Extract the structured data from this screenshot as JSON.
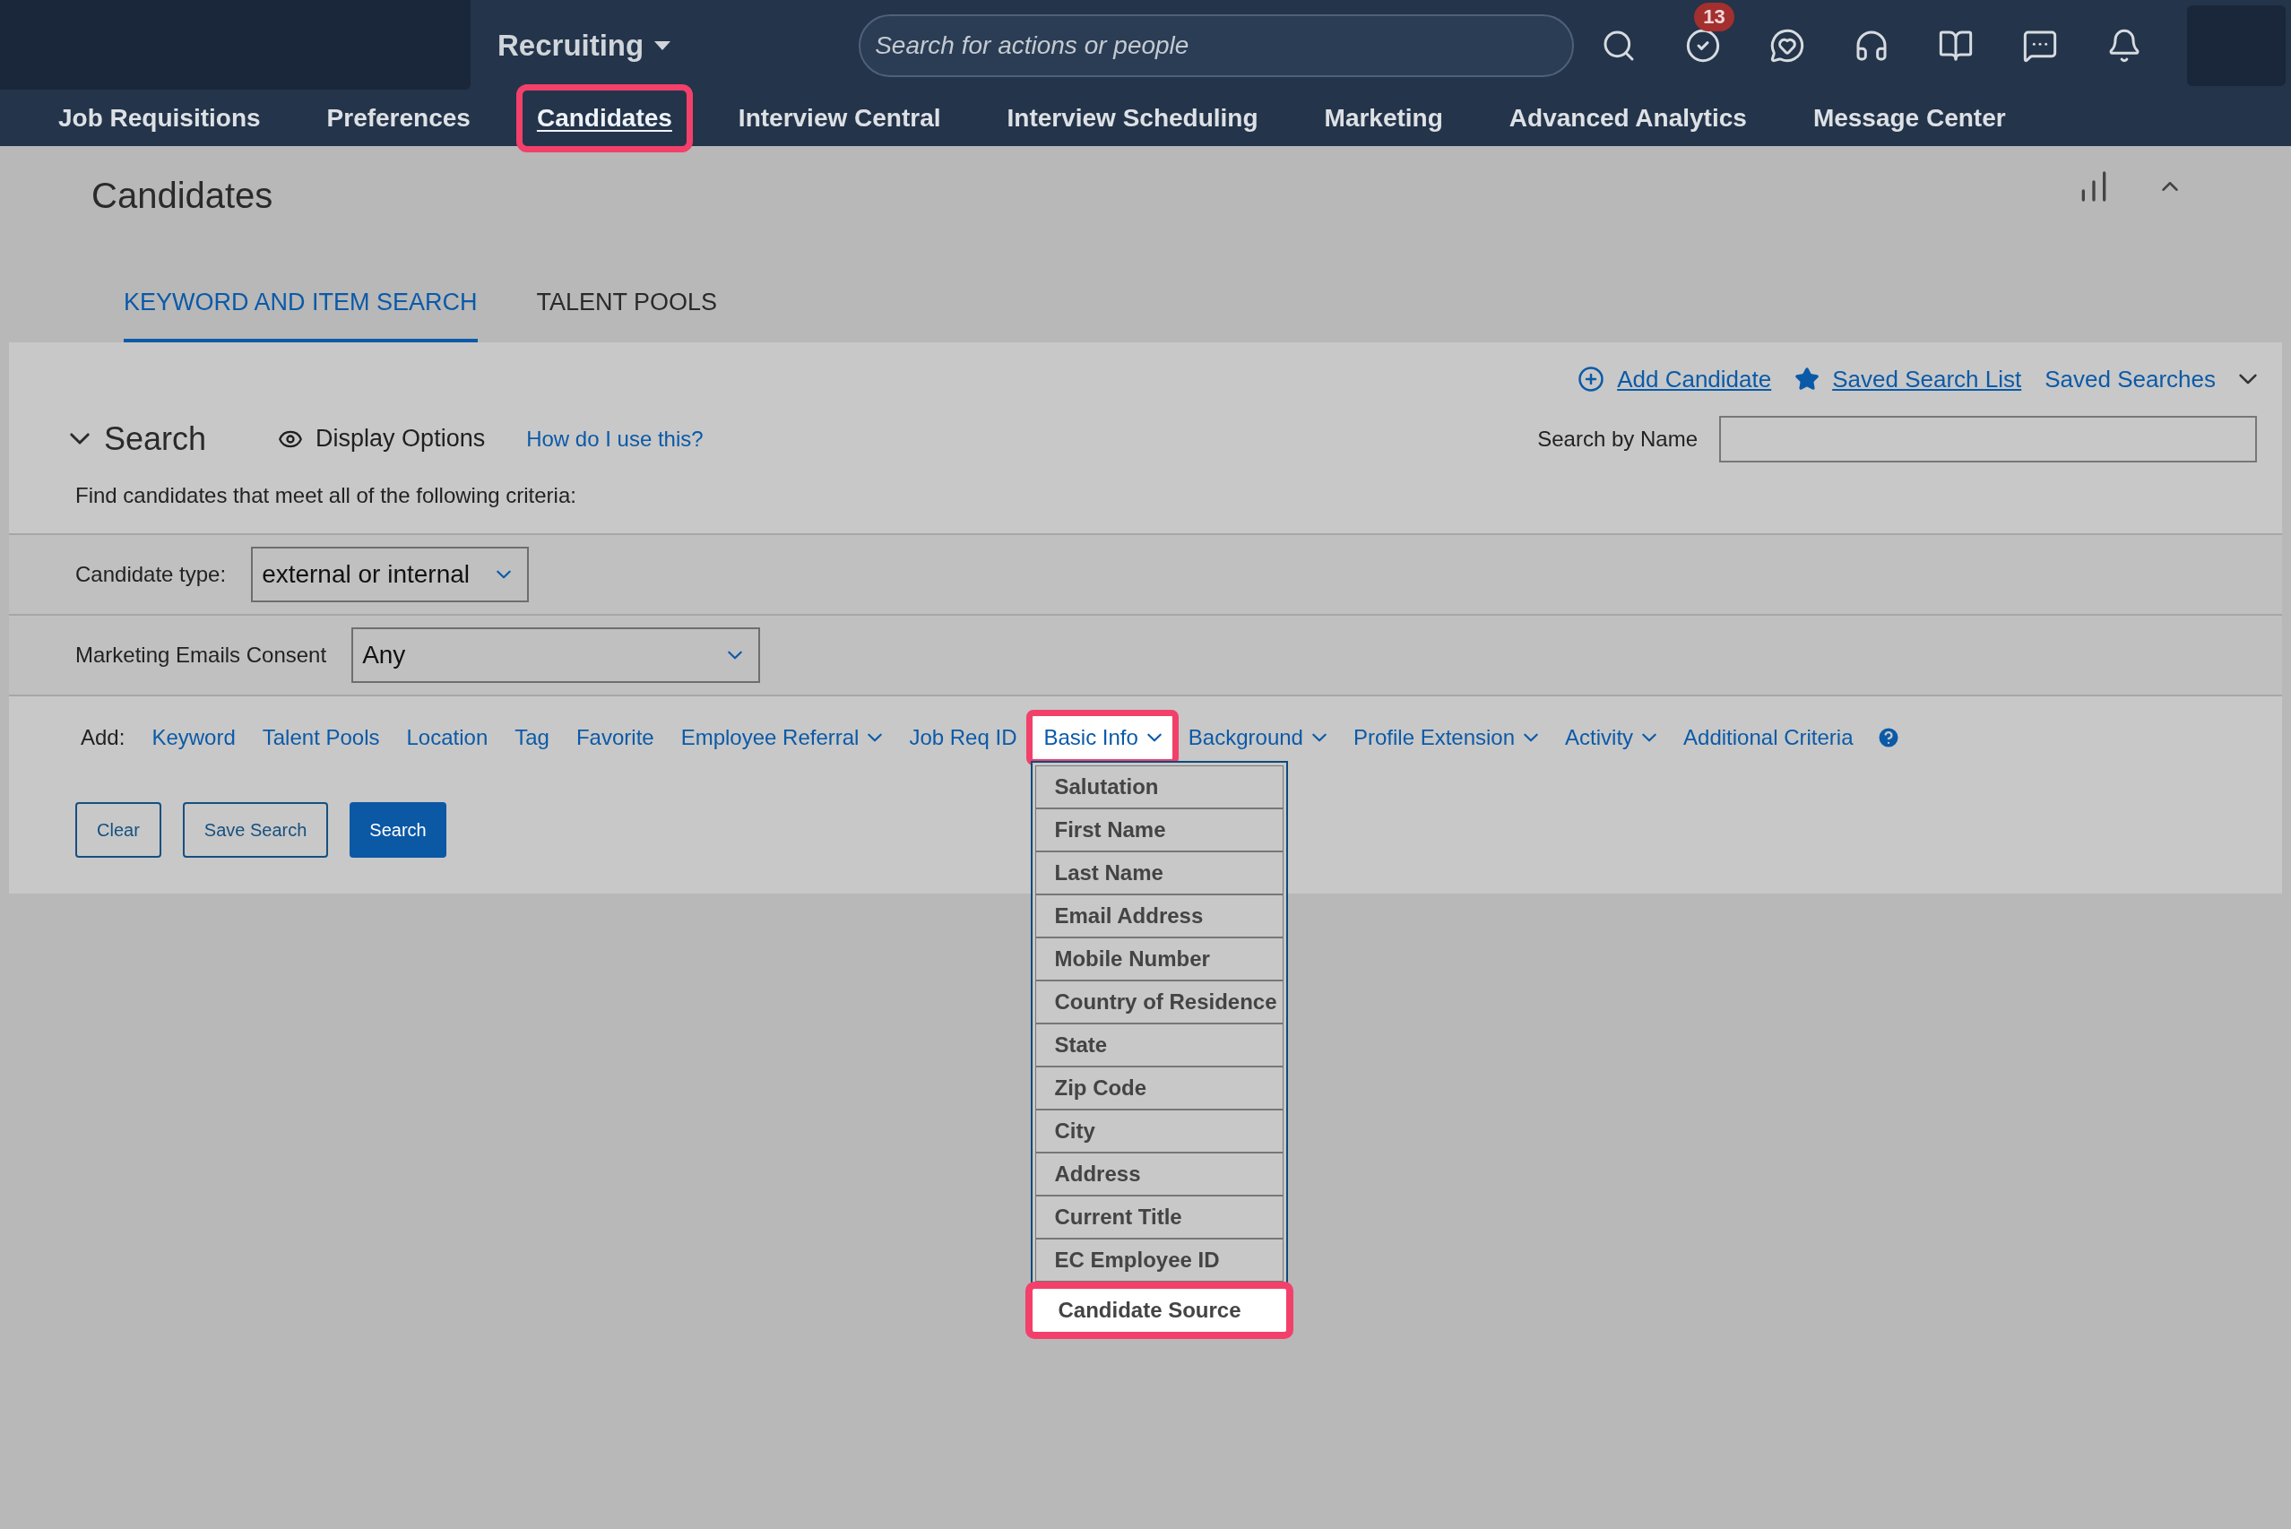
{
  "header": {
    "app_menu": "Recruiting",
    "search_placeholder": "Search for actions or people",
    "badge": "13"
  },
  "nav": [
    {
      "label": "Job Requisitions",
      "selected": false,
      "highlighted": false
    },
    {
      "label": "Preferences",
      "selected": false,
      "highlighted": false
    },
    {
      "label": "Candidates",
      "selected": true,
      "highlighted": true
    },
    {
      "label": "Interview Central",
      "selected": false,
      "highlighted": false
    },
    {
      "label": "Interview Scheduling",
      "selected": false,
      "highlighted": false
    },
    {
      "label": "Marketing",
      "selected": false,
      "highlighted": false
    },
    {
      "label": "Advanced Analytics",
      "selected": false,
      "highlighted": false
    },
    {
      "label": "Message Center",
      "selected": false,
      "highlighted": false
    }
  ],
  "page_title": "Candidates",
  "tabs": [
    {
      "label": "KEYWORD AND ITEM SEARCH",
      "selected": true
    },
    {
      "label": "TALENT POOLS",
      "selected": false
    }
  ],
  "actions": [
    {
      "label": "Add Candidate",
      "kind": "add"
    },
    {
      "label": "Saved Search List",
      "kind": "list"
    },
    {
      "label": "Saved Searches",
      "kind": "menu"
    }
  ],
  "search": {
    "title": "Search",
    "expanded": true,
    "display_options": "Display Options",
    "help_link": "How do I use this?",
    "description": "Find candidates that meet all of the following criteria:",
    "name_label": "Search by Name"
  },
  "filters": [
    {
      "label": "Candidate type:",
      "value": "external or internal"
    },
    {
      "label": "Marketing Emails Consent",
      "value": "Any"
    }
  ],
  "add": {
    "label": "Add:",
    "items": [
      {
        "label": "Keyword",
        "kind": "link",
        "open": false,
        "highlighted": false
      },
      {
        "label": "Talent Pools",
        "kind": "link",
        "open": false,
        "highlighted": false
      },
      {
        "label": "Location",
        "kind": "link",
        "open": false,
        "highlighted": false
      },
      {
        "label": "Tag",
        "kind": "link",
        "open": false,
        "highlighted": false
      },
      {
        "label": "Favorite",
        "kind": "link",
        "open": false,
        "highlighted": false
      },
      {
        "label": "Employee Referral",
        "kind": "menu",
        "open": false,
        "highlighted": false
      },
      {
        "label": "Job Req ID",
        "kind": "link",
        "open": false,
        "highlighted": false
      },
      {
        "label": "Basic Info",
        "kind": "menu",
        "open": true,
        "highlighted": true
      },
      {
        "label": "Background",
        "kind": "menu",
        "open": false,
        "highlighted": false
      },
      {
        "label": "Profile Extension",
        "kind": "menu",
        "open": false,
        "highlighted": false
      },
      {
        "label": "Activity",
        "kind": "menu",
        "open": false,
        "highlighted": false
      },
      {
        "label": "Additional Criteria",
        "kind": "link",
        "open": false,
        "highlighted": false
      }
    ]
  },
  "buttons": [
    {
      "label": "Clear",
      "kind": "outline"
    },
    {
      "label": "Save Search",
      "kind": "outline"
    },
    {
      "label": "Search",
      "kind": "primary"
    }
  ],
  "dropdown": {
    "items": [
      {
        "label": "Salutation",
        "highlighted": false
      },
      {
        "label": "First Name",
        "highlighted": false
      },
      {
        "label": "Last Name",
        "highlighted": false
      },
      {
        "label": "Email Address",
        "highlighted": false
      },
      {
        "label": "Mobile Number",
        "highlighted": false
      },
      {
        "label": "Country of Residence",
        "highlighted": false
      },
      {
        "label": "State",
        "highlighted": false
      },
      {
        "label": "Zip Code",
        "highlighted": false
      },
      {
        "label": "City",
        "highlighted": false
      },
      {
        "label": "Address",
        "highlighted": false
      },
      {
        "label": "Current Title",
        "highlighted": false
      },
      {
        "label": "EC Employee ID",
        "highlighted": false
      },
      {
        "label": "Candidate Source",
        "highlighted": true
      }
    ]
  }
}
